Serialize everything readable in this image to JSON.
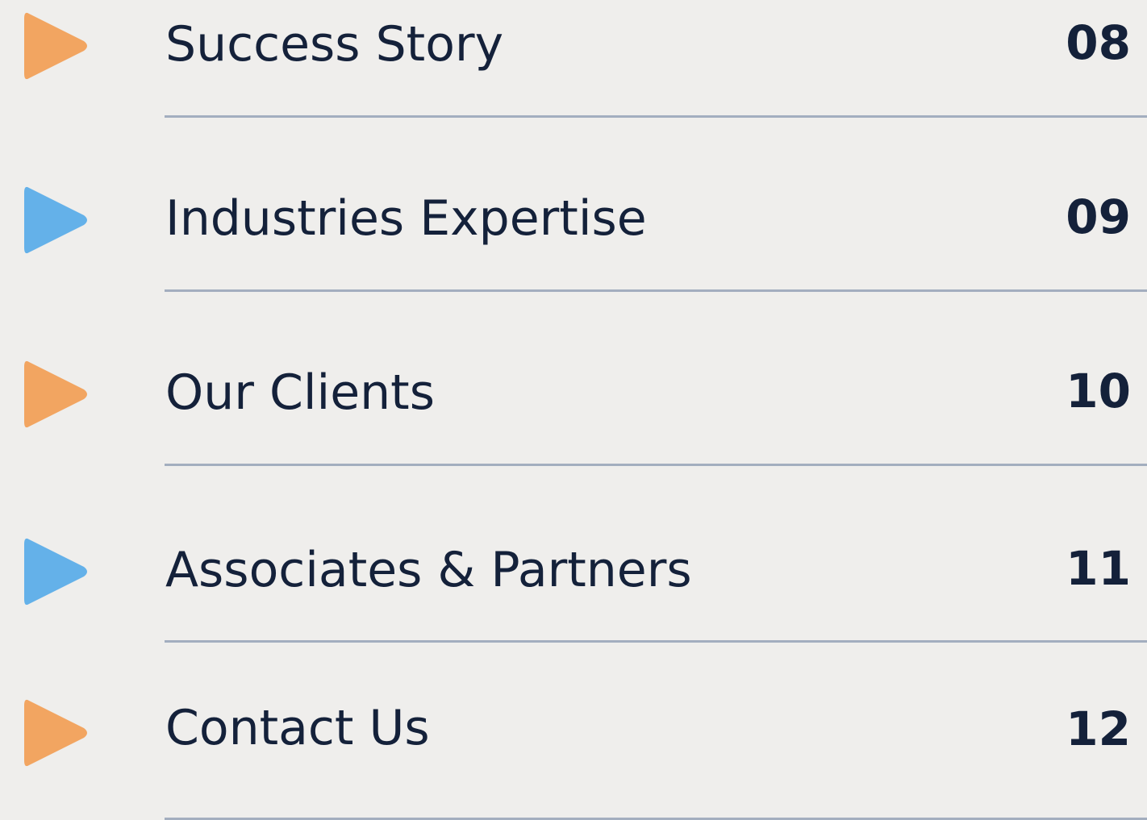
{
  "colors": {
    "orange": "#f2a561",
    "blue": "#64b1e9",
    "text": "#14213a",
    "divider": "#a3aebf",
    "background": "#efeeec"
  },
  "toc": {
    "items": [
      {
        "label": "Success Story",
        "page": "08",
        "arrow_color": "orange",
        "icon": "play-arrow-icon"
      },
      {
        "label": "Industries Expertise",
        "page": "09",
        "arrow_color": "blue",
        "icon": "play-arrow-icon"
      },
      {
        "label": "Our Clients",
        "page": "10",
        "arrow_color": "orange",
        "icon": "play-arrow-icon"
      },
      {
        "label": "Associates & Partners",
        "page": "11",
        "arrow_color": "blue",
        "icon": "play-arrow-icon"
      },
      {
        "label": "Contact Us",
        "page": "12",
        "arrow_color": "orange",
        "icon": "play-arrow-icon"
      }
    ]
  }
}
